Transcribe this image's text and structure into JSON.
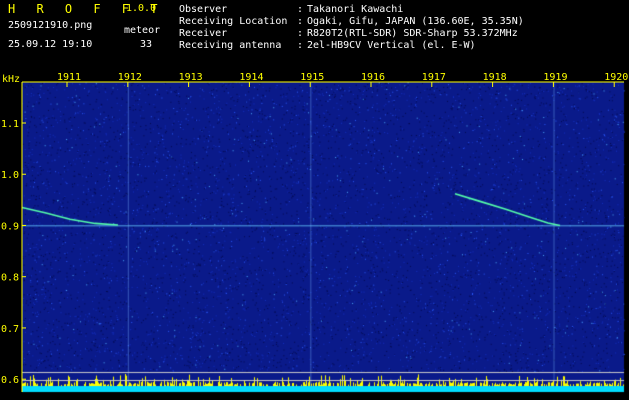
{
  "app": {
    "title": "H R O F F T",
    "version": "1.0.0"
  },
  "file": {
    "name": "2509121910.png"
  },
  "status": {
    "timestamp": "25.09.12 19:10",
    "mode": "meteor",
    "count": "33"
  },
  "info": [
    {
      "label": "Observer",
      "value": "Takanori Kawachi"
    },
    {
      "label": "Receiving Location",
      "value": "Ogaki, Gifu, JAPAN (136.60E, 35.35N)"
    },
    {
      "label": "Receiver",
      "value": "R820T2(RTL-SDR) SDR-Sharp 53.372MHz"
    },
    {
      "label": "Receiving antenna",
      "value": "2el-HB9CV Vertical (el. E-W)"
    }
  ],
  "axis": {
    "unit": "kHz",
    "time_ticks": [
      "1911",
      "1912",
      "1913",
      "1914",
      "1915",
      "1916",
      "1917",
      "1918",
      "1919",
      "1920"
    ],
    "freq_ticks": [
      "1.1",
      "1.0",
      "0.9",
      "0.8",
      "0.7",
      "0.6"
    ]
  },
  "colors": {
    "background": "#000000",
    "noise": "#0a1a8a",
    "carrier": "#66ccff",
    "echo": "#55ffaa",
    "axis_text": "#ffff00",
    "level": "#ffff00",
    "level_base": "#00ddff"
  }
}
